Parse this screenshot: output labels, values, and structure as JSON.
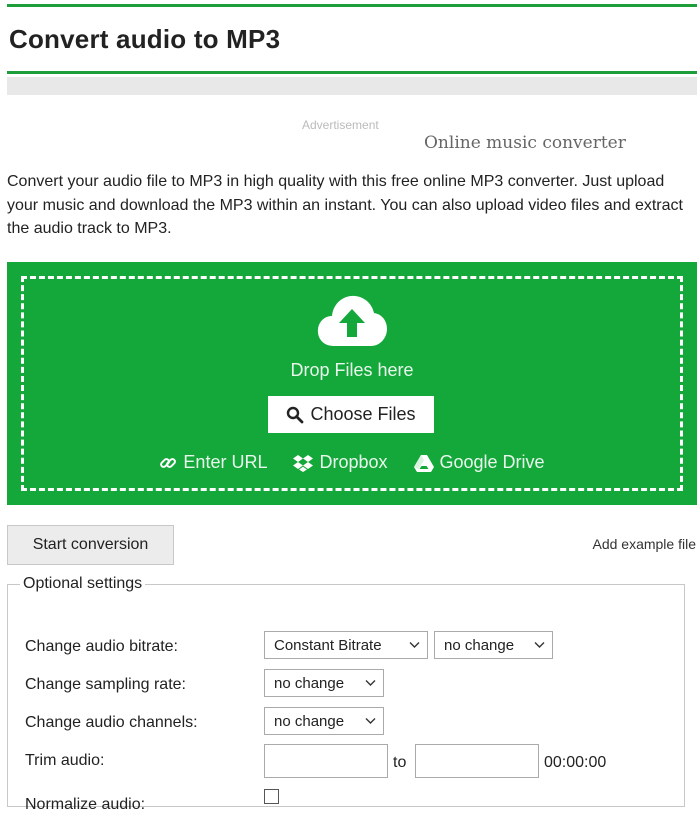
{
  "header": {
    "title": "Convert audio to MP3"
  },
  "ad": {
    "label": "Advertisement",
    "text": "Online music converter"
  },
  "intro": "Convert your audio file to MP3 in high quality with this free online MP3 converter. Just upload your music and download the MP3 within an instant. You can also upload video files and extract the audio track to MP3.",
  "upload": {
    "drop_text": "Drop Files here",
    "choose_label": "Choose Files",
    "links": {
      "url": "Enter URL",
      "dropbox": "Dropbox",
      "gdrive": "Google Drive"
    }
  },
  "actions": {
    "start_label": "Start conversion",
    "example_label": "Add example file"
  },
  "settings": {
    "legend": "Optional settings",
    "bitrate_label": "Change audio bitrate:",
    "bitrate_mode": "Constant Bitrate",
    "bitrate_value": "no change",
    "sampling_label": "Change sampling rate:",
    "sampling_value": "no change",
    "channels_label": "Change audio channels:",
    "channels_value": "no change",
    "trim_label": "Trim audio:",
    "trim_to": "to",
    "trim_time": "00:00:00",
    "normalize_label": "Normalize audio:"
  },
  "colors": {
    "brand_green": "#14a73a",
    "rule_green": "#1e9e3a"
  }
}
